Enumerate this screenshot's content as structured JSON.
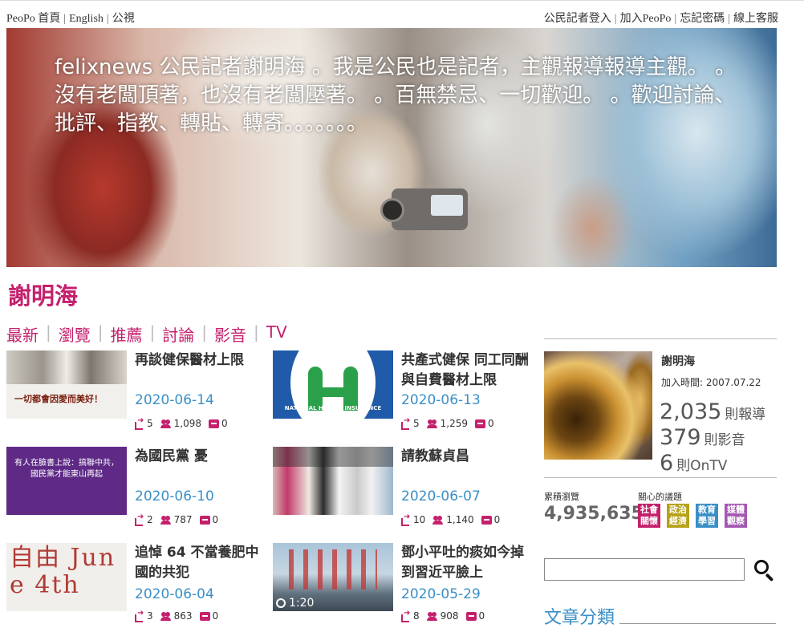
{
  "topbar": {
    "left_links": [
      "PeoPo 首頁",
      "English",
      "公視"
    ],
    "right_links": [
      "公民記者登入",
      "加入PeoPo",
      "忘記密碼",
      "線上客服"
    ]
  },
  "banner": {
    "motto": "felixnews 公民記者謝明海 。我是公民也是記者，主觀報導報導主觀。 。沒有老闆頂著，也沒有老闆壓著。 。百無禁忌、一切歡迎。 。歡迎討論、批評、指教、轉貼、轉寄。。。。。。。"
  },
  "reporter": {
    "title": "謝明海"
  },
  "tabs": [
    "最新",
    "瀏覽",
    "推薦",
    "討論",
    "影音",
    "TV"
  ],
  "articles": [
    {
      "title": "再談健保醫材上限",
      "date": "2020-06-14",
      "shares": "5",
      "views": "1,098",
      "comments": "0",
      "thumb_text": "一切都會因愛而美好！"
    },
    {
      "title": "共產式健保 同工同酬與自費醫材上限",
      "date": "2020-06-13",
      "shares": "5",
      "views": "1,259",
      "comments": "0",
      "thumb_text": "NATIONAL HEALTH INSURANCE"
    },
    {
      "title": "為國民黨 憂",
      "date": "2020-06-10",
      "shares": "2",
      "views": "787",
      "comments": "0",
      "thumb_text": "有人在臉書上說：搞聯中共，國民黨才能東山再起"
    },
    {
      "title": "請教蘇貞昌",
      "date": "2020-06-07",
      "shares": "10",
      "views": "1,140",
      "comments": "0",
      "thumb_text": ""
    },
    {
      "title": "追悼 64 不當養肥中國的共犯",
      "date": "2020-06-04",
      "shares": "3",
      "views": "863",
      "comments": "0",
      "thumb_text": "自由 June 4th"
    },
    {
      "title": "鄧小平吐的痰如今掉到習近平臉上",
      "date": "2020-05-29",
      "shares": "8",
      "views": "908",
      "comments": "0",
      "thumb_text": "",
      "video_duration": "1:20"
    }
  ],
  "profile": {
    "name": "謝明海",
    "join_label": "加入時間: 2007.07.22",
    "reports_count": "2,035",
    "reports_unit": "則報導",
    "videos_count": "379",
    "videos_unit": "則影音",
    "ontv_count": "6",
    "ontv_unit": "則OnTV",
    "total_views_label": "累積瀏覽",
    "total_views": "4,935,635",
    "topics_label": "關心的議題",
    "topics": [
      {
        "text": "社會關懷",
        "color": "#c4206c"
      },
      {
        "text": "政治經濟",
        "color": "#b5a11a"
      },
      {
        "text": "教育學習",
        "color": "#3a8fc6"
      },
      {
        "text": "媒體觀察",
        "color": "#a558b3"
      }
    ]
  },
  "search": {
    "placeholder": ""
  },
  "category": {
    "heading": "文章分類"
  }
}
